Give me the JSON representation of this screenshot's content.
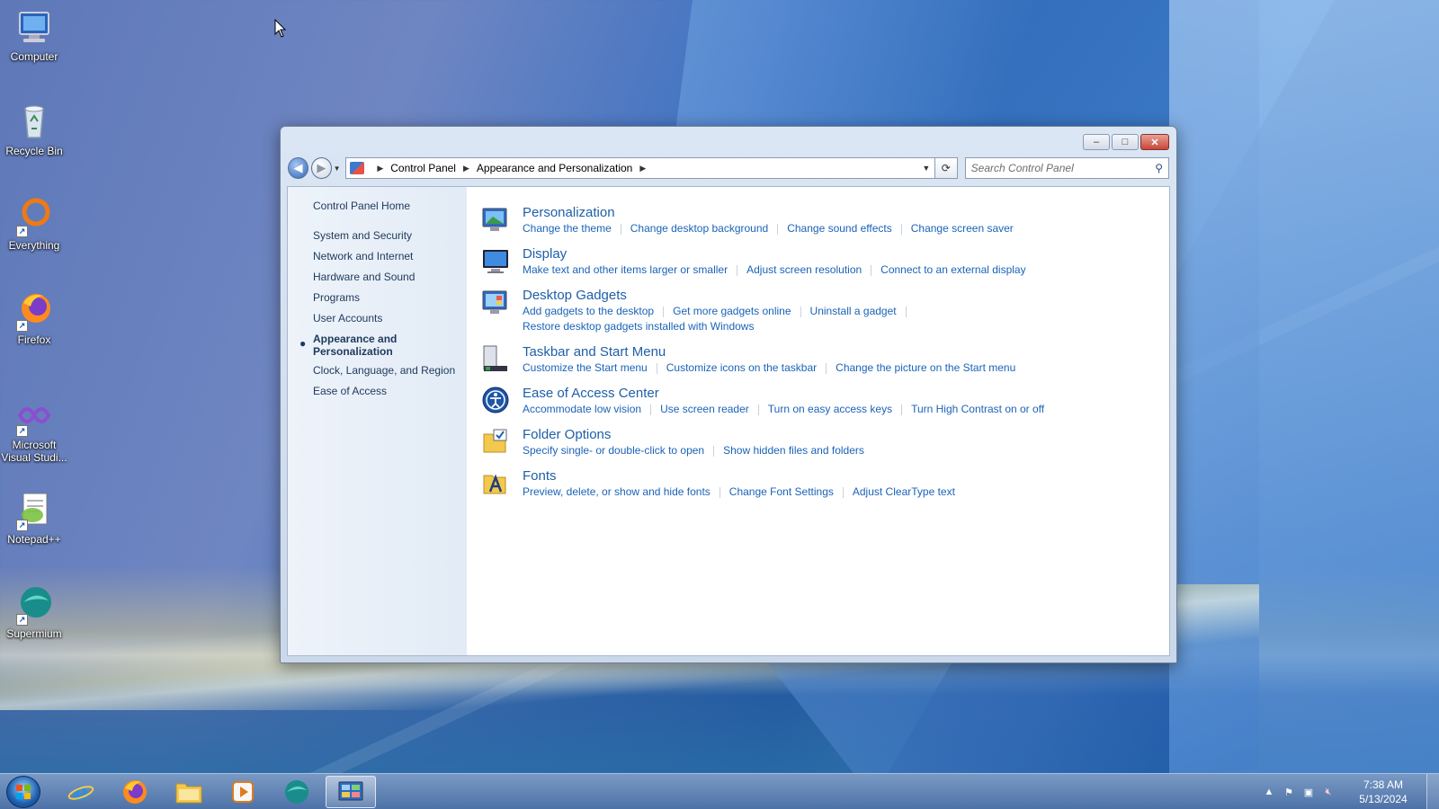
{
  "desktop": {
    "icons": [
      {
        "label": "Computer",
        "icon": "computer-icon"
      },
      {
        "label": "Recycle Bin",
        "icon": "recycle-bin-icon"
      },
      {
        "label": "Everything",
        "icon": "everything-icon"
      },
      {
        "label": "Firefox",
        "icon": "firefox-icon"
      },
      {
        "label": "Microsoft Visual Studi...",
        "icon": "visual-studio-icon"
      },
      {
        "label": "Notepad++",
        "icon": "notepad-plus-plus-icon"
      },
      {
        "label": "Supermium",
        "icon": "supermium-icon"
      }
    ]
  },
  "window": {
    "address": {
      "crumbs": [
        "Control Panel",
        "Appearance and Personalization"
      ]
    },
    "search": {
      "placeholder": "Search Control Panel"
    },
    "controls": {
      "minimize": "–",
      "maximize": "□",
      "close": "✕"
    },
    "sidebar": {
      "home": "Control Panel Home",
      "items": [
        "System and Security",
        "Network and Internet",
        "Hardware and Sound",
        "Programs",
        "User Accounts",
        "Appearance and Personalization",
        "Clock, Language, and Region",
        "Ease of Access"
      ],
      "current_index": 5
    },
    "categories": [
      {
        "title": "Personalization",
        "icon": "personalization-icon",
        "links": [
          "Change the theme",
          "Change desktop background",
          "Change sound effects",
          "Change screen saver"
        ],
        "links2": []
      },
      {
        "title": "Display",
        "icon": "display-icon",
        "links": [
          "Make text and other items larger or smaller",
          "Adjust screen resolution",
          "Connect to an external display"
        ],
        "links2": []
      },
      {
        "title": "Desktop Gadgets",
        "icon": "desktop-gadgets-icon",
        "links": [
          "Add gadgets to the desktop",
          "Get more gadgets online",
          "Uninstall a gadget"
        ],
        "links2": [
          "Restore desktop gadgets installed with Windows"
        ]
      },
      {
        "title": "Taskbar and Start Menu",
        "icon": "taskbar-icon",
        "links": [
          "Customize the Start menu",
          "Customize icons on the taskbar",
          "Change the picture on the Start menu"
        ],
        "links2": []
      },
      {
        "title": "Ease of Access Center",
        "icon": "ease-of-access-icon",
        "links": [
          "Accommodate low vision",
          "Use screen reader",
          "Turn on easy access keys",
          "Turn High Contrast on or off"
        ],
        "links2": []
      },
      {
        "title": "Folder Options",
        "icon": "folder-options-icon",
        "links": [
          "Specify single- or double-click to open",
          "Show hidden files and folders"
        ],
        "links2": []
      },
      {
        "title": "Fonts",
        "icon": "fonts-icon",
        "links": [
          "Preview, delete, or show and hide fonts",
          "Change Font Settings",
          "Adjust ClearType text"
        ],
        "links2": []
      }
    ]
  },
  "taskbar": {
    "pinned": [
      "internet-explorer-icon",
      "firefox-icon",
      "file-explorer-icon",
      "media-player-icon",
      "supermium-icon",
      "control-panel-icon"
    ],
    "active_index": 5,
    "clock": {
      "time": "7:38 AM",
      "date": "5/13/2024"
    }
  }
}
